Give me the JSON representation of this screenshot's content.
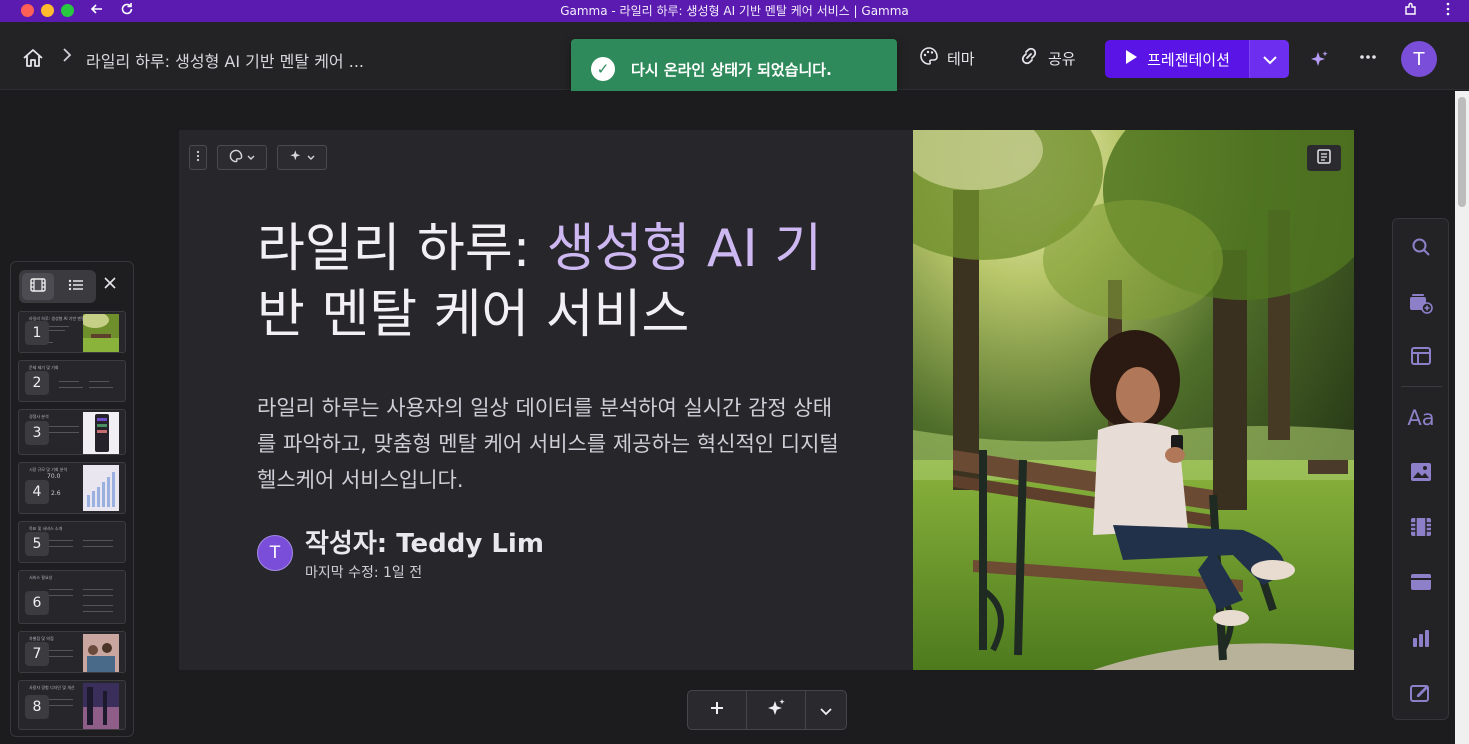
{
  "window": {
    "title": "Gamma - 라일리 하루: 생성형 AI 기반 멘탈 케어 서비스 | Gamma"
  },
  "header": {
    "breadcrumb": "라일리 하루: 생성형 AI 기반 멘탈 케어 ...",
    "theme_label": "테마",
    "share_label": "공유",
    "present_label": "프레젠테이션",
    "avatar_initial": "T"
  },
  "toast": {
    "message": "다시 온라인 상태가 되었습니다."
  },
  "slide": {
    "title_white": "라일리 하루: ",
    "title_purple": "생성형 AI 기",
    "title_line2": "반 멘탈 케어 서비스",
    "description": "라일리 하루는 사용자의 일상 데이터를 분석하여 실시간 감정 상태를 파악하고, 맞춤형 멘탈 케어 서비스를 제공하는 혁신적인 디지털 헬스케어 서비스입니다.",
    "author_initial": "T",
    "author": "작성자: Teddy Lim",
    "modified": "마지막 수정: 1일 전"
  },
  "thumbnails": [
    {
      "number": "1",
      "label": "라일리 하루: 생성형 AI 기반 멘탈"
    },
    {
      "number": "2",
      "label": "문제 제기 및 기회"
    },
    {
      "number": "3",
      "label": "경쟁사 분석"
    },
    {
      "number": "4",
      "label": "시장 규모 및 기회 분석",
      "stat1": "70.0",
      "stat2": "2.6"
    },
    {
      "number": "5",
      "label": "목표 및 서비스 소개"
    },
    {
      "number": "6",
      "label": "서비스 필요성"
    },
    {
      "number": "7",
      "label": "차별점 및 약점"
    },
    {
      "number": "8",
      "label": "사용자 경험 디자인 및 개선"
    }
  ],
  "colors": {
    "titlebar": "#5b1bb0",
    "accent": "#5a14e6",
    "toast": "#2e8a5a",
    "title_purple": "#cdb8f2",
    "avatar": "#7a4ed8"
  },
  "icons": {
    "right_toolbar": [
      "search-icon",
      "add-card-icon",
      "layout-icon",
      "text-icon",
      "image-icon",
      "video-icon",
      "embed-icon",
      "chart-icon",
      "edit-icon"
    ]
  }
}
